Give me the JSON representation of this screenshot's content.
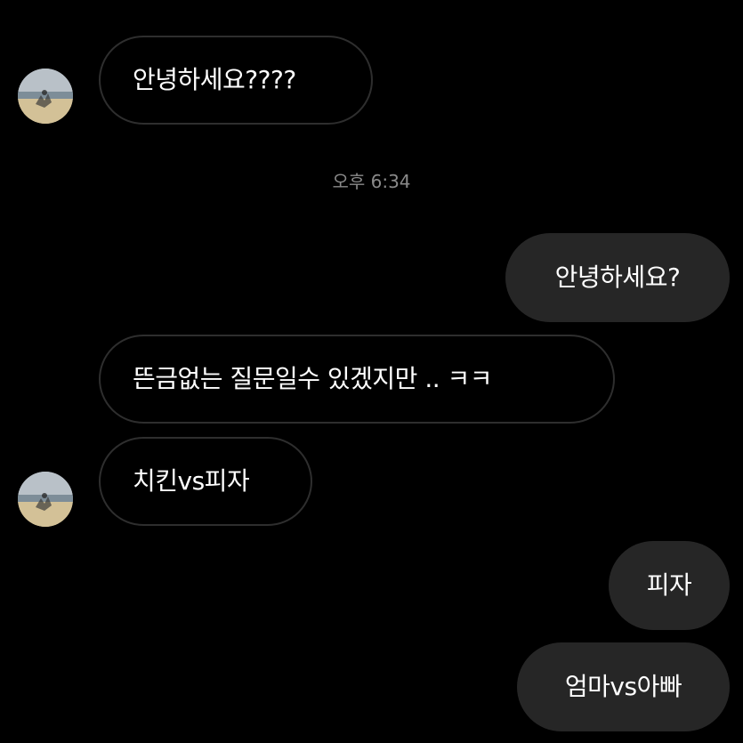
{
  "conversation": {
    "timestamp": "오후 6:34",
    "messages": [
      {
        "from": "them",
        "text": "안녕하세요????"
      },
      {
        "from": "me",
        "text": "안녕하세요?"
      },
      {
        "from": "them",
        "text": "뜬금없는 질문일수 있겠지만 .. ㅋㅋ"
      },
      {
        "from": "them",
        "text": "치킨vs피자"
      },
      {
        "from": "me",
        "text": "피자"
      },
      {
        "from": "me",
        "text": "엄마vs아빠"
      }
    ]
  },
  "colors": {
    "background": "#000000",
    "incoming_border": "#2e2e2e",
    "outgoing_fill": "#262626",
    "timestamp_text": "#8a8a8a"
  },
  "icons": {
    "avatar": "profile-photo-beach"
  }
}
